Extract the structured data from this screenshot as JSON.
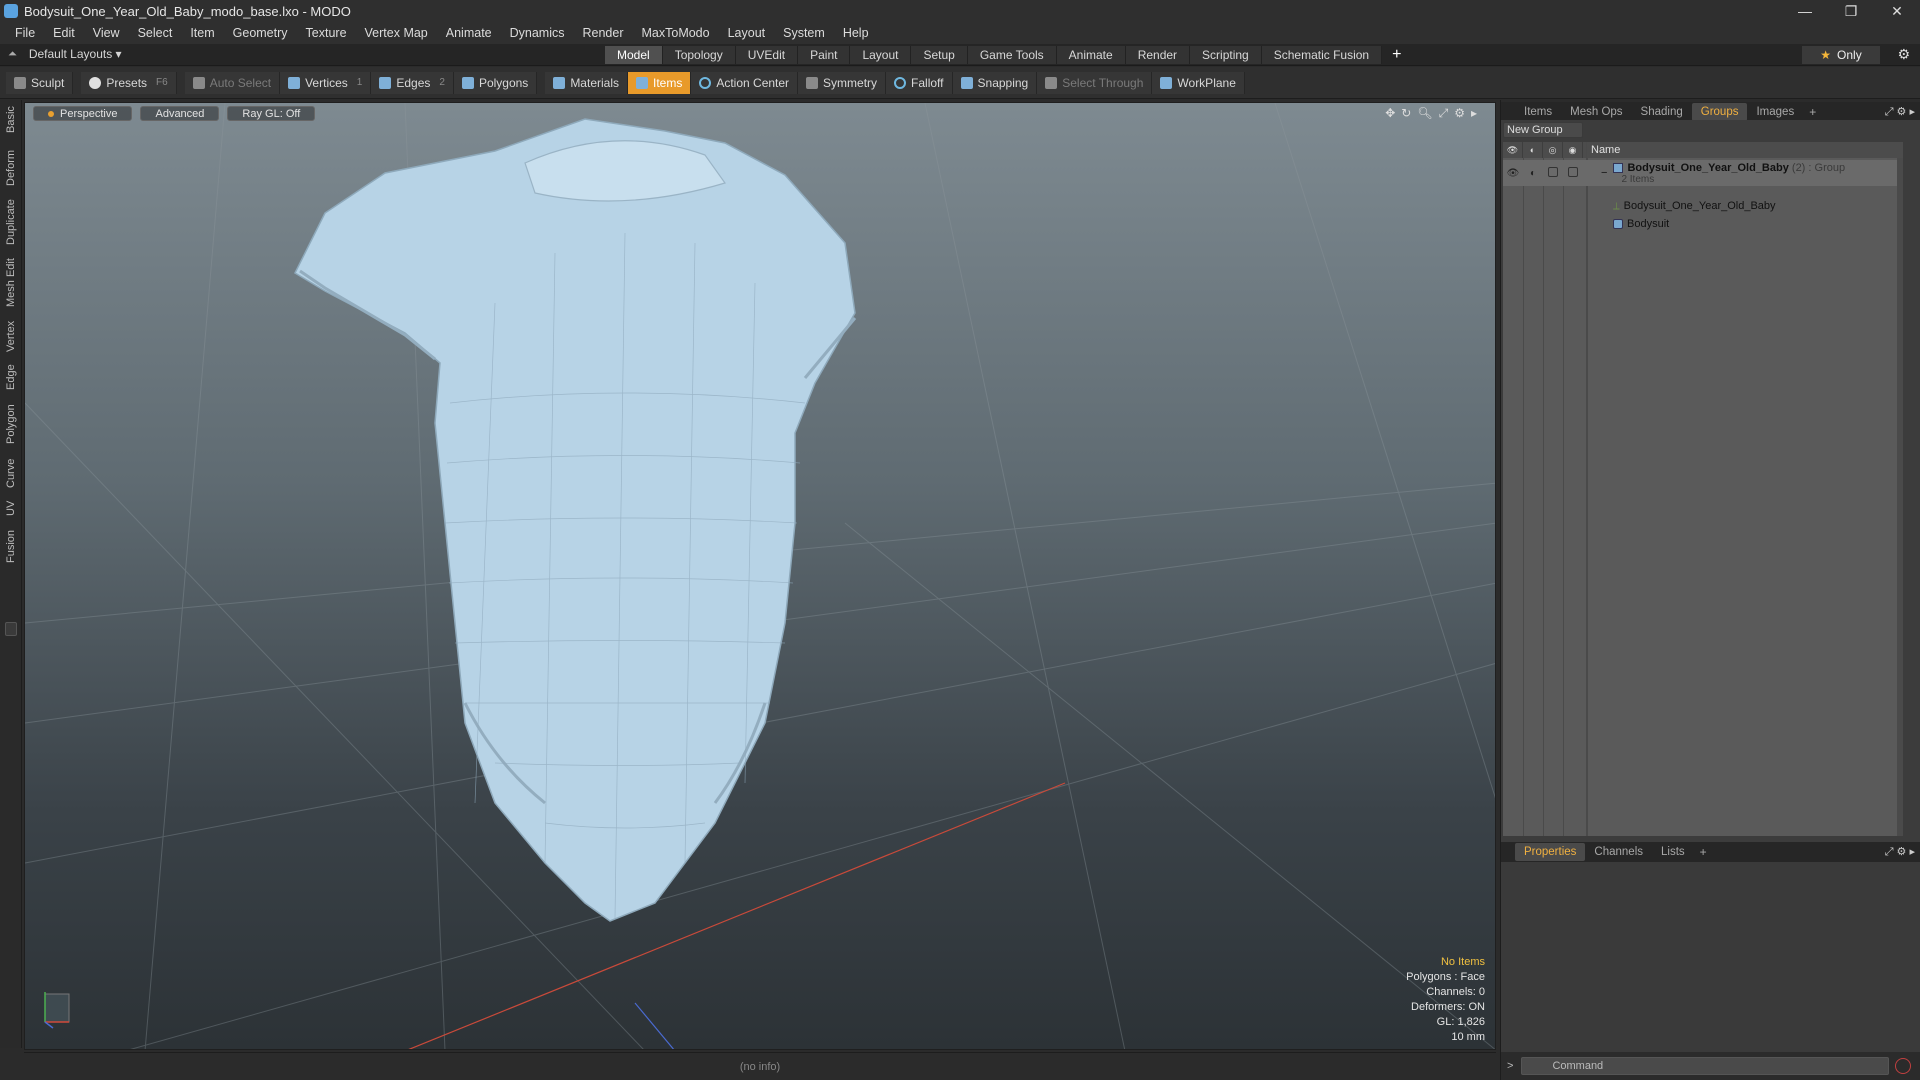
{
  "window": {
    "title": "Bodysuit_One_Year_Old_Baby_modo_base.lxo - MODO",
    "controls": [
      "—",
      "❐",
      "✕"
    ]
  },
  "menu": [
    "File",
    "Edit",
    "View",
    "Select",
    "Item",
    "Geometry",
    "Texture",
    "Vertex Map",
    "Animate",
    "Dynamics",
    "Render",
    "MaxToModo",
    "Layout",
    "System",
    "Help"
  ],
  "layout": {
    "selector": "Default Layouts ▾",
    "tabs": [
      "Model",
      "Topology",
      "UVEdit",
      "Paint",
      "Layout",
      "Setup",
      "Game Tools",
      "Animate",
      "Render",
      "Scripting",
      "Schematic Fusion"
    ],
    "active_tab": "Model",
    "only_label": "Only"
  },
  "toolbar": {
    "sculpt": "Sculpt",
    "presets": "Presets",
    "presets_key": "F6",
    "auto_select": "Auto Select",
    "vertices": "Vertices",
    "vertices_key": "1",
    "edges": "Edges",
    "edges_key": "2",
    "polygons": "Polygons",
    "materials": "Materials",
    "items": "Items",
    "action_center": "Action Center",
    "symmetry": "Symmetry",
    "falloff": "Falloff",
    "snapping": "Snapping",
    "select_through": "Select Through",
    "workplane": "WorkPlane"
  },
  "left_tabs": [
    "Basic",
    "Deform",
    "Duplicate",
    "Mesh Edit",
    "Vertex",
    "Edge",
    "Polygon",
    "Curve",
    "UV",
    "Fusion"
  ],
  "viewport": {
    "view": "Perspective",
    "mode": "Advanced",
    "raygl": "Ray GL: Off",
    "info": {
      "no_items": "No Items",
      "polygons": "Polygons : Face",
      "channels": "Channels: 0",
      "deformers": "Deformers: ON",
      "gl": "GL: 1,826",
      "scale": "10 mm"
    }
  },
  "status": "(no info)",
  "right_top_tabs": [
    "Items",
    "Mesh Ops",
    "Shading",
    "Groups",
    "Images"
  ],
  "right_top_active": "Groups",
  "groups": {
    "new_group": "New Group",
    "header_name": "Name",
    "root": {
      "name": "Bodysuit_One_Year_Old_Baby",
      "count": "(2)",
      "type": ": Group",
      "sub": "2 Items"
    },
    "children": [
      "Bodysuit_One_Year_Old_Baby",
      "Bodysuit"
    ]
  },
  "right_bottom_tabs": [
    "Properties",
    "Channels",
    "Lists"
  ],
  "right_bottom_active": "Properties",
  "command": {
    "prompt": ">",
    "placeholder": "Command"
  },
  "colors": {
    "accent": "#e89a2a",
    "active_tab_text": "#f0b040",
    "mesh": "#b7d3e6"
  }
}
